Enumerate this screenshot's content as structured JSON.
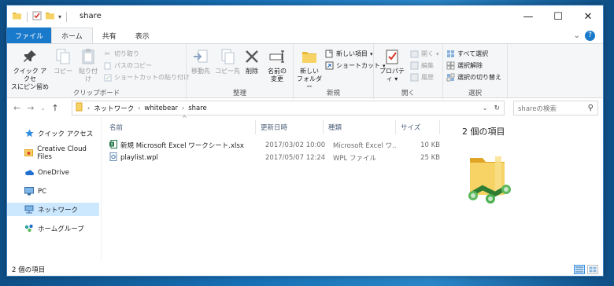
{
  "window": {
    "title": "share"
  },
  "tabs": {
    "file": "ファイル",
    "home": "ホーム",
    "share": "共有",
    "view": "表示"
  },
  "ribbon": {
    "clipboard": {
      "label": "クリップボード",
      "pin": "クイック アクセ\nスにピン留め",
      "copy": "コピー",
      "paste": "貼り付け",
      "cut": "切り取り",
      "copy_path": "パスのコピー",
      "paste_shortcut": "ショートカットの貼り付け"
    },
    "organize": {
      "label": "整理",
      "move_to": "移動先",
      "copy_to": "コピー先",
      "delete": "削除",
      "rename": "名前の\n変更"
    },
    "new": {
      "label": "新規",
      "new_folder": "新しい\nフォルダー",
      "new_item": "新しい項目",
      "shortcut": "ショートカット"
    },
    "open": {
      "label": "開く",
      "properties": "プロパティ",
      "open": "開く",
      "edit": "編集",
      "history": "履歴"
    },
    "select": {
      "label": "選択",
      "select_all": "すべて選択",
      "select_none": "選択解除",
      "invert": "選択の切り替え"
    }
  },
  "address": {
    "path": [
      "ネットワーク",
      "whitebear",
      "share"
    ],
    "search_placeholder": "shareの検索"
  },
  "navpane": {
    "items": [
      {
        "label": "クイック アクセス",
        "icon": "star-icon"
      },
      {
        "label": "Creative Cloud Files",
        "icon": "creative-cloud-icon"
      },
      {
        "label": "OneDrive",
        "icon": "cloud-icon"
      },
      {
        "label": "PC",
        "icon": "monitor-icon"
      },
      {
        "label": "ネットワーク",
        "icon": "network-icon"
      },
      {
        "label": "ホームグループ",
        "icon": "homegroup-icon"
      }
    ]
  },
  "filelist": {
    "headers": {
      "name": "名前",
      "date": "更新日時",
      "type": "種類",
      "size": "サイズ"
    },
    "rows": [
      {
        "name": "新規 Microsoft Excel ワークシート.xlsx",
        "date": "2017/03/02 10:00",
        "type": "Microsoft Excel ワ...",
        "size": "10 KB"
      },
      {
        "name": "playlist.wpl",
        "date": "2017/05/07 12:24",
        "type": "WPL ファイル",
        "size": "25 KB"
      }
    ]
  },
  "details": {
    "title": "2 個の項目"
  },
  "status": {
    "count": "2 個の項目"
  },
  "colors": {
    "accent": "#1979ca",
    "selection": "#cce8ff"
  }
}
